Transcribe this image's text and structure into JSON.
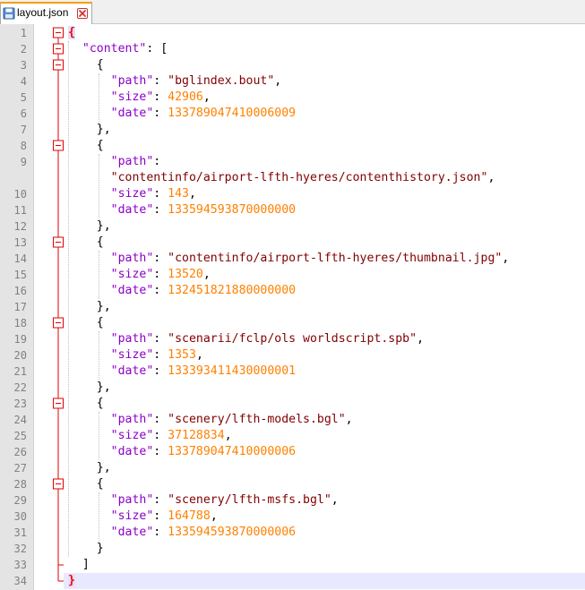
{
  "tab": {
    "filename": "layout.json",
    "accent_color": "#f5a000"
  },
  "editor": {
    "line_numbers": [
      "1",
      "2",
      "3",
      "4",
      "5",
      "6",
      "7",
      "8",
      "9",
      "10",
      "11",
      "12",
      "13",
      "14",
      "15",
      "16",
      "17",
      "18",
      "19",
      "20",
      "21",
      "22",
      "23",
      "24",
      "25",
      "26",
      "27",
      "28",
      "29",
      "30",
      "31",
      "32",
      "33",
      "34"
    ],
    "key_color": "#8b00c8",
    "string_color": "#800000",
    "number_color": "#ff8000",
    "fold_color": "#e00000",
    "json": {
      "root_open": "{",
      "root_close": "}",
      "content_key": "\"content\"",
      "array_open": "[",
      "array_close": "]",
      "path_key": "\"path\"",
      "size_key": "\"size\"",
      "date_key": "\"date\"",
      "entries": [
        {
          "path": "\"bglindex.bout\"",
          "size": "42906",
          "date": "133789047410006009"
        },
        {
          "path": "\"contentinfo/airport-lfth-hyeres/contenthistory.json\"",
          "size": "143",
          "date": "133594593870000000"
        },
        {
          "path": "\"contentinfo/airport-lfth-hyeres/thumbnail.jpg\"",
          "size": "13520",
          "date": "132451821880000000"
        },
        {
          "path": "\"scenarii/fclp/ols worldscript.spb\"",
          "size": "1353",
          "date": "133393411430000001"
        },
        {
          "path": "\"scenery/lfth-models.bgl\"",
          "size": "37128834",
          "date": "133789047410000006"
        },
        {
          "path": "\"scenery/lfth-msfs.bgl\"",
          "size": "164788",
          "date": "133594593870000006"
        }
      ]
    }
  }
}
